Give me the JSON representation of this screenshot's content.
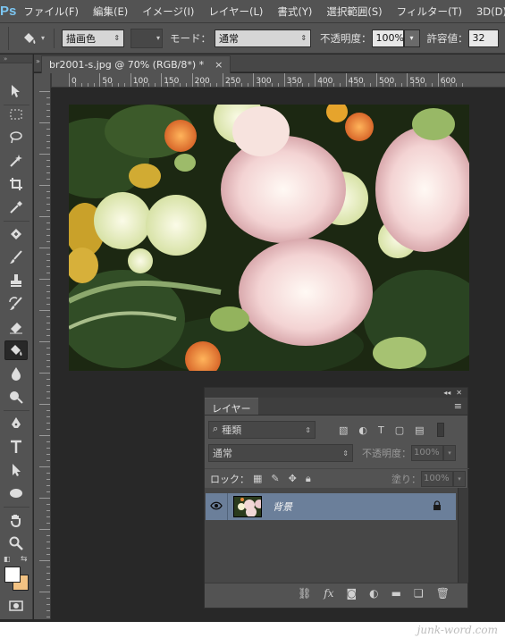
{
  "app": {
    "logo": "Ps"
  },
  "menu": [
    "ファイル(F)",
    "編集(E)",
    "イメージ(I)",
    "レイヤー(L)",
    "書式(Y)",
    "選択範囲(S)",
    "フィルター(T)",
    "3D(D)"
  ],
  "options": {
    "tool_icon": "paint-bucket-icon",
    "fill_source": "描画色",
    "mode_label": "モード：",
    "mode_value": "通常",
    "opacity_label": "不透明度：",
    "opacity_value": "100%",
    "tolerance_label": "許容値：",
    "tolerance_value": "32"
  },
  "document": {
    "tab_title": "br2001-s.jpg @ 70% (RGB/8*) *",
    "close_glyph": "×"
  },
  "ruler": {
    "labels": [
      "0",
      "50",
      "100",
      "150",
      "200",
      "250",
      "300",
      "350",
      "400",
      "450",
      "500",
      "550",
      "600"
    ]
  },
  "layers_panel": {
    "tab_label": "レイヤー",
    "tab_menu_glyph": "≡",
    "filter_kind": "種類",
    "blend_mode": "通常",
    "opacity_label": "不透明度：",
    "opacity_value": "100%",
    "lock_label": "ロック：",
    "fill_label": "塗り：",
    "fill_value": "100%",
    "layers": [
      {
        "name": "背景",
        "visible": true,
        "locked": true
      }
    ]
  },
  "watermark": "junk-word.com",
  "colors": {
    "accent_logo": "#7cc6f2",
    "selected_layer": "#6b7f9a",
    "foreground": "#ffffff",
    "background": "#f2c283"
  }
}
